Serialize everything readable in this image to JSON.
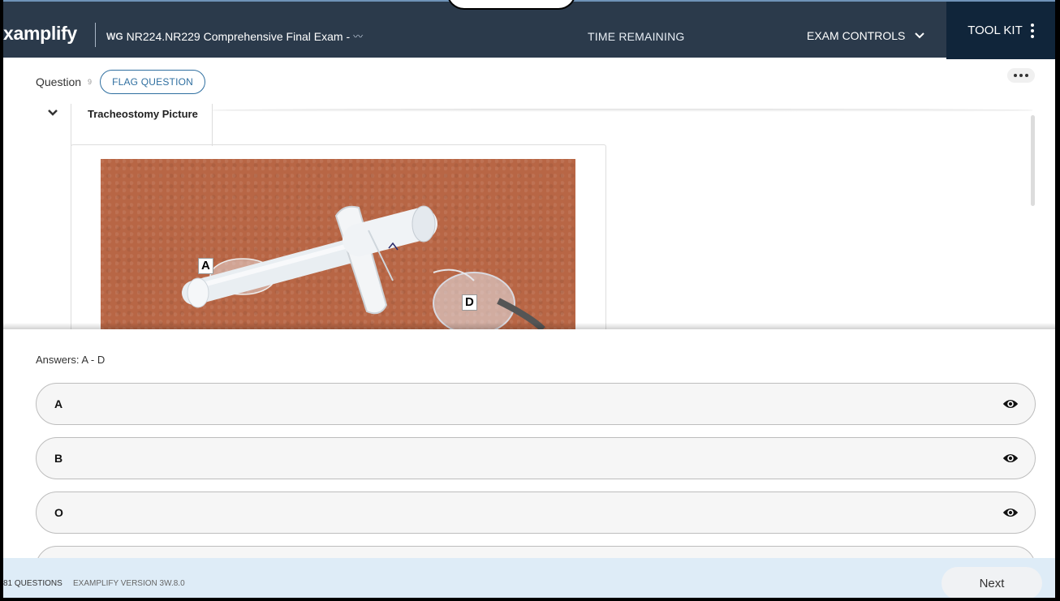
{
  "header": {
    "brand": "xamplify",
    "exam_prefix": "WG",
    "exam_title": "NR224.NR229 Comprehensive Final Exam -",
    "time_remaining_label": "TIME REMAINING",
    "exam_controls_label": "EXAM CONTROLS",
    "toolkit_label": "TOOL KIT"
  },
  "question": {
    "label": "Question",
    "number": "9",
    "flag_label": "FLAG QUESTION"
  },
  "exhibit": {
    "tab_title": "Tracheostomy Picture",
    "labels": [
      "A",
      "D"
    ]
  },
  "answers": {
    "label": "Answers: A - D",
    "items": [
      {
        "text": "A"
      },
      {
        "text": "B"
      },
      {
        "text": "O"
      },
      {
        "text": ""
      }
    ]
  },
  "footer": {
    "question_count": "81 QUESTIONS",
    "version": "EXAMPLIFY VERSION 3W.8.0",
    "next_label": "Next"
  },
  "colors": {
    "header_bg": "#2b3a4b",
    "toolkit_bg": "#10253a",
    "accent": "#2f6fa0",
    "footer_bg": "#deecf7"
  }
}
